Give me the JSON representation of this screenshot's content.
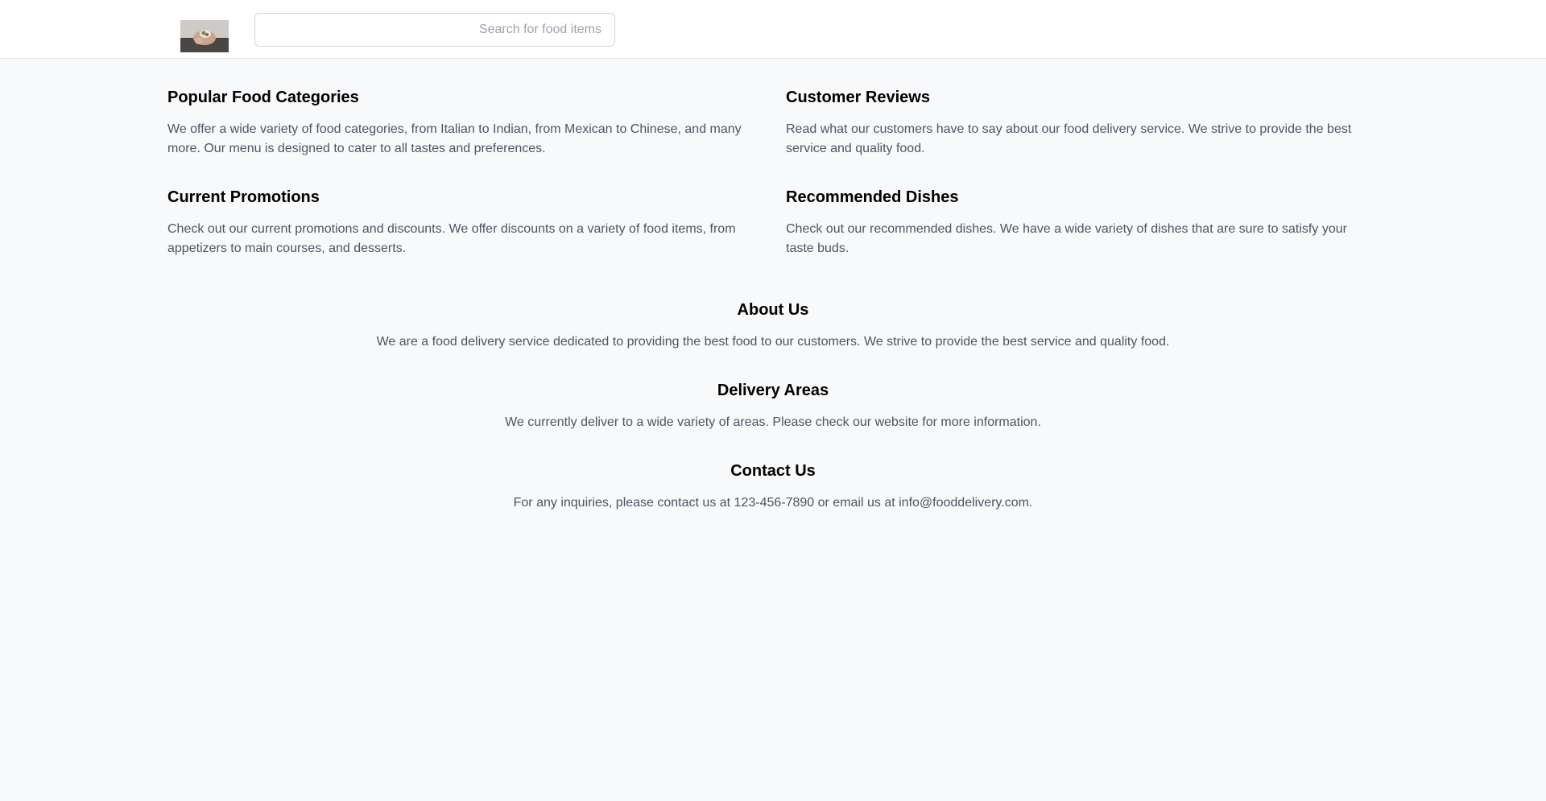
{
  "header": {
    "logo_alt": "Food delivery logo",
    "search": {
      "placeholder": "Search for food items",
      "value": ""
    }
  },
  "sections": {
    "popular": {
      "title": "Popular Food Categories",
      "text": "We offer a wide variety of food categories, from Italian to Indian, from Mexican to Chinese, and many more. Our menu is designed to cater to all tastes and preferences."
    },
    "reviews": {
      "title": "Customer Reviews",
      "text": "Read what our customers have to say about our food delivery service. We strive to provide the best service and quality food."
    },
    "promotions": {
      "title": "Current Promotions",
      "text": "Check out our current promotions and discounts. We offer discounts on a variety of food items, from appetizers to main courses, and desserts."
    },
    "recommended": {
      "title": "Recommended Dishes",
      "text": "Check out our recommended dishes. We have a wide variety of dishes that are sure to satisfy your taste buds."
    },
    "about": {
      "title": "About Us",
      "text": "We are a food delivery service dedicated to providing the best food to our customers. We strive to provide the best service and quality food."
    },
    "delivery": {
      "title": "Delivery Areas",
      "text": "We currently deliver to a wide variety of areas. Please check our website for more information."
    },
    "contact": {
      "title": "Contact Us",
      "text": "For any inquiries, please contact us at 123-456-7890 or email us at info@fooddelivery.com."
    }
  },
  "colors": {
    "page_background": "#f8f9fb",
    "header_background": "#ffffff",
    "heading": "#000000",
    "body_text": "#4b5563",
    "border": "#d1d5db"
  }
}
